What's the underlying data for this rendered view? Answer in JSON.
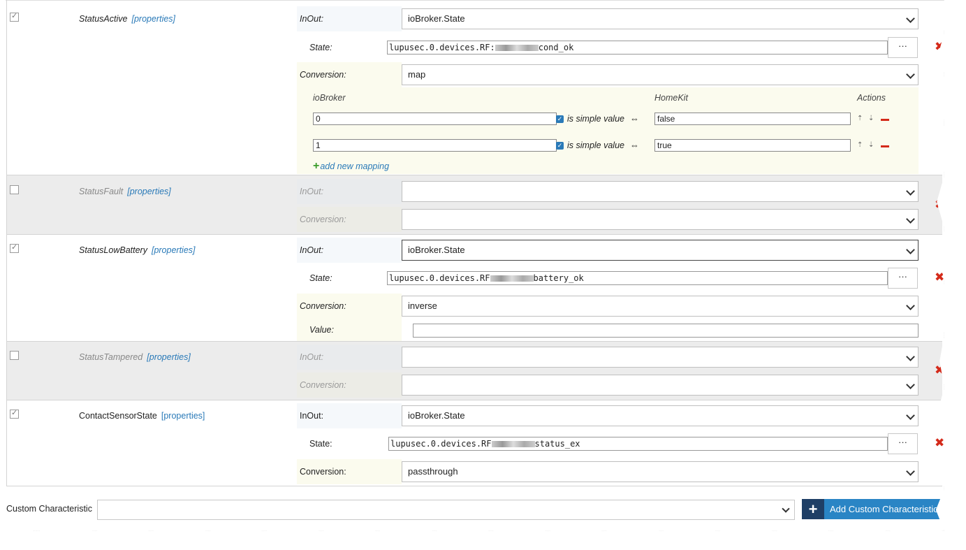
{
  "characteristics": [
    {
      "name": "StatusActive",
      "enabled": true,
      "properties_link": "[properties]",
      "inout_label": "InOut:",
      "inout_value": "ioBroker.State",
      "state_label": "State:",
      "state_prefix": "lupusec.0.devices.RF:",
      "state_suffix": "cond_ok",
      "conversion_label": "Conversion:",
      "conversion_value": "map",
      "mapping": {
        "col_iobroker": "ioBroker",
        "col_homekit": "HomeKit",
        "col_actions": "Actions",
        "rows": [
          {
            "iobroker": "0",
            "simple_label": "is simple value",
            "arrow": "⇔",
            "homekit": "false"
          },
          {
            "iobroker": "1",
            "simple_label": "is simple value",
            "arrow": "⇔",
            "homekit": "true"
          }
        ],
        "add_label": "add new mapping"
      },
      "delete_icon": "✖"
    },
    {
      "name": "StatusFault",
      "enabled": false,
      "properties_link": "[properties]",
      "inout_label": "InOut:",
      "inout_value": "",
      "conversion_label": "Conversion:",
      "conversion_value": "",
      "delete_icon": "✖"
    },
    {
      "name": "StatusLowBattery",
      "enabled": true,
      "properties_link": "[properties]",
      "inout_label": "InOut:",
      "inout_value": "ioBroker.State",
      "state_label": "State:",
      "state_prefix": "lupusec.0.devices.RF",
      "state_suffix": "battery_ok",
      "conversion_label": "Conversion:",
      "conversion_value": "inverse",
      "value_label": "Value:",
      "delete_icon": "✖"
    },
    {
      "name": "StatusTampered",
      "enabled": false,
      "properties_link": "[properties]",
      "inout_label": "InOut:",
      "inout_value": "",
      "conversion_label": "Conversion:",
      "conversion_value": "",
      "delete_icon": "✖"
    },
    {
      "name": "ContactSensorState",
      "enabled": true,
      "properties_link": "[properties]",
      "inout_label": "InOut:",
      "inout_value": "ioBroker.State",
      "state_label": "State:",
      "state_prefix": "lupusec.0.devices.RF",
      "state_suffix": "status_ex",
      "conversion_label": "Conversion:",
      "conversion_value": "passthrough",
      "delete_icon": "✖"
    }
  ],
  "dots_button": "···",
  "footer": {
    "custom_label": "Custom Characteristic",
    "custom_value": "",
    "add_button": "Add Custom Characteristic",
    "add_icon": "+"
  },
  "colors": {
    "accent": "#2a85c5",
    "delete": "#d42a1a",
    "add_green": "#3a9c2a"
  }
}
